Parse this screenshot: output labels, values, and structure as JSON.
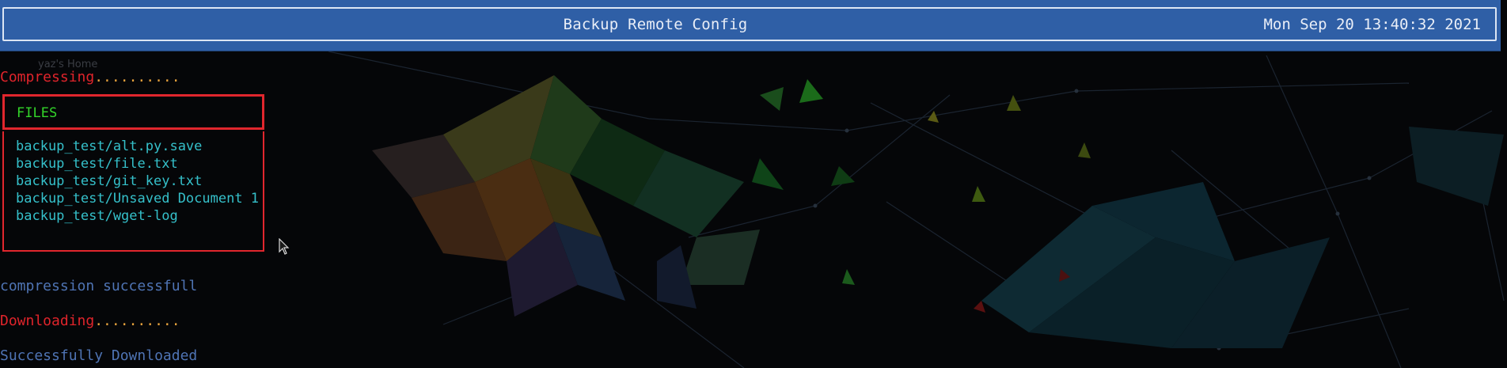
{
  "window": {
    "title": "Backup Remote Config",
    "clock": "Mon Sep 20 13:40:32 2021"
  },
  "desktop": {
    "label": "yaz's Home"
  },
  "terminal": {
    "compressing_word": "Compressing",
    "compressing_dots": "..........",
    "files_header": "FILES",
    "files": [
      "backup_test/alt.py.save",
      "backup_test/file.txt",
      "backup_test/git_key.txt",
      "backup_test/Unsaved Document 1",
      "backup_test/wget-log"
    ],
    "compression_result": "compression successfull",
    "downloading_word": "Downloading",
    "downloading_dots": "..........",
    "download_result": "Successfully Downloaded"
  },
  "colors": {
    "titlebar": "#2f5fa6",
    "error_red": "#e0242b",
    "progress_orange": "#e8a33d",
    "info_blue": "#4f74b4",
    "file_cyan": "#35c0ca",
    "header_green": "#33d42a"
  },
  "icons": {
    "cursor": "mouse-pointer-icon"
  }
}
